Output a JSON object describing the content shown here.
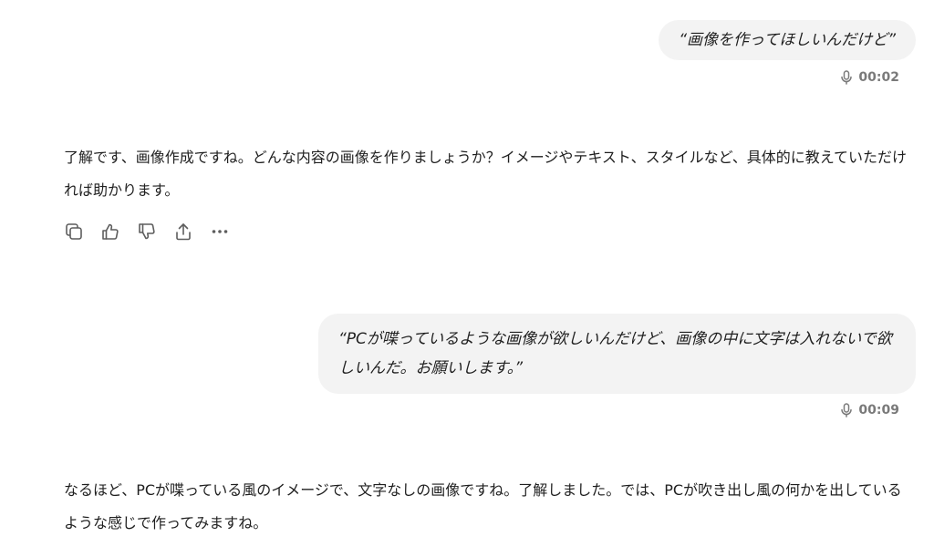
{
  "messages": {
    "user1": {
      "text": "“画像を作ってほしいんだけど”",
      "duration": "00:02"
    },
    "assistant1": {
      "text": "了解です、画像作成ですね。どんな内容の画像を作りましょうか？イメージやテキスト、スタイルなど、具体的に教えていただければ助かります。"
    },
    "user2": {
      "text": "“PCが喋っているような画像が欲しいんだけど、画像の中に文字は入れないで欲しいんだ。お願いします。”",
      "duration": "00:09"
    },
    "assistant2": {
      "text": "なるほど、PCが喋っている風のイメージで、文字なしの画像ですね。了解しました。では、PCが吹き出し風の何かを出しているような感じで作ってみますね。"
    }
  },
  "actions": {
    "icons": [
      "copy-icon",
      "thumbs-up-icon",
      "thumbs-down-icon",
      "share-icon",
      "more-icon"
    ]
  },
  "icons": {
    "voice": "microphone-icon"
  },
  "colors": {
    "user_bubble_bg": "#f3f3f3",
    "meta_text": "#7a7a7a",
    "body_text": "#1f1f1f"
  }
}
